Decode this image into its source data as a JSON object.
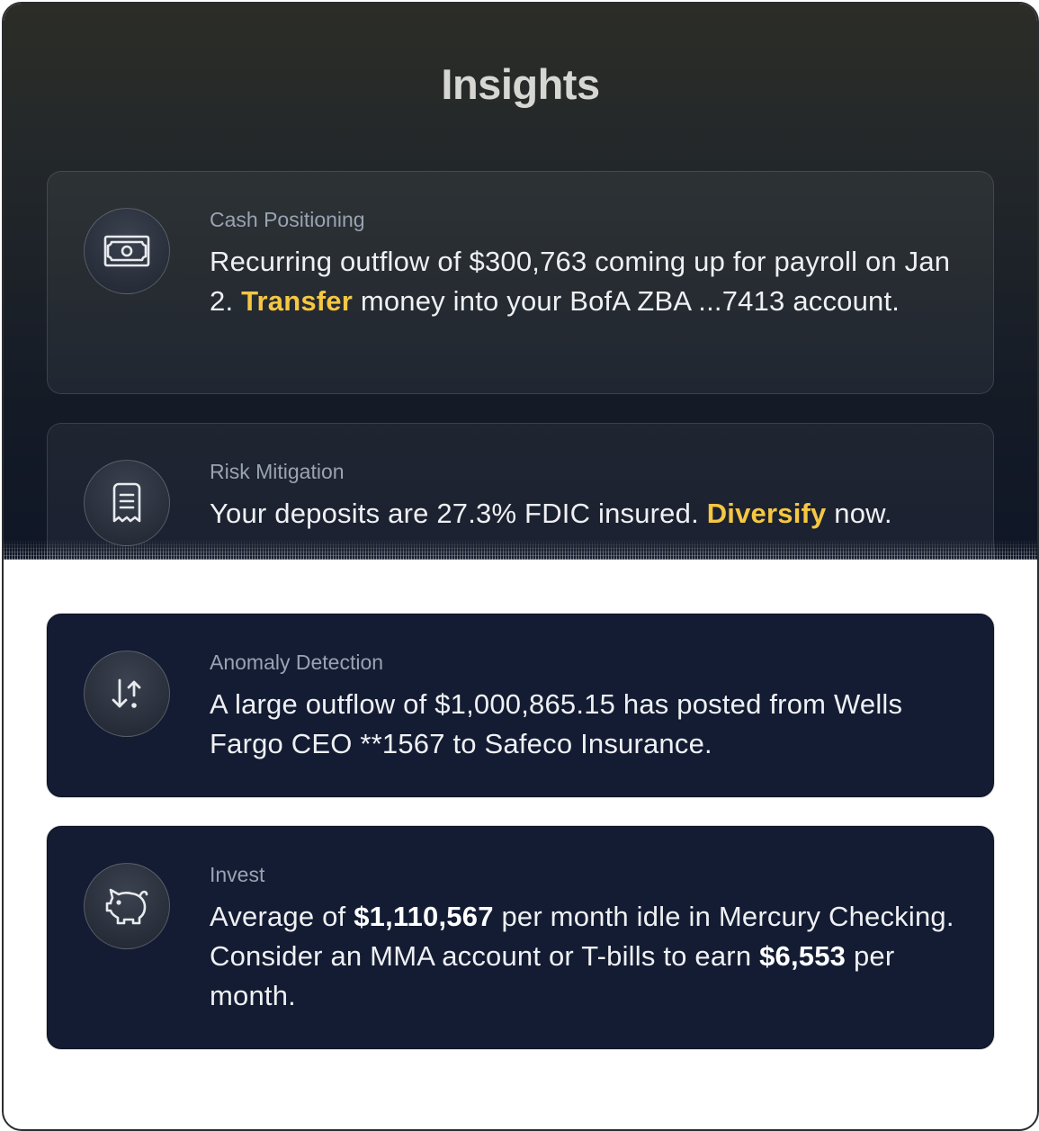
{
  "page_title": "Insights",
  "insights": {
    "cash": {
      "category": "Cash Positioning",
      "text_before": "Recurring outflow of $300,763 coming up for payroll on Jan 2. ",
      "action_label": "Transfer",
      "text_after": " money into your BofA ZBA ...7413 account.",
      "icon": "cash-icon"
    },
    "risk": {
      "category": "Risk Mitigation",
      "text_before": "Your deposits are 27.3% FDIC insured. ",
      "action_label": "Diversify",
      "text_after": " now.",
      "icon": "receipt-icon"
    },
    "anomaly": {
      "category": "Anomaly Detection",
      "text": "A large outflow of $1,000,865.15 has posted from Wells Fargo CEO **1567 to Safeco Insurance.",
      "icon": "arrows-up-down-icon"
    },
    "invest": {
      "category": "Invest",
      "text_1": "Average of ",
      "amount_1": "$1,110,567",
      "text_2": " per month idle in Mercury Checking. Consider an MMA account or T-bills to earn ",
      "amount_2": "$6,553",
      "text_3": " per month.",
      "icon": "piggy-bank-icon"
    }
  },
  "colors": {
    "accent_link": "#f5c742",
    "card_dark": "#141c33",
    "category_text": "#9aa3b2"
  }
}
